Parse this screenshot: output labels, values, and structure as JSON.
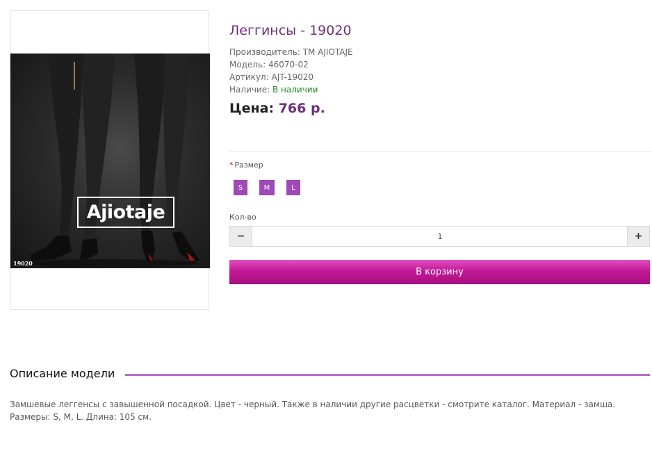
{
  "product": {
    "image_alt": "Леггинсы - 19020",
    "brand_logo": "Ajiotaje",
    "sku_tag": "19020",
    "title": "Леггинсы - 19020",
    "manufacturer_label": "Производитель:",
    "manufacturer_value": "TM AJIOTAJE",
    "model_label": "Модель:",
    "model_value": "46070-02",
    "article_label": "Артикул:",
    "article_value": "AJT-19020",
    "availability_label": "Наличие:",
    "availability_value": "В наличии",
    "price_label": "Цена:",
    "price_value": "766 р."
  },
  "options": {
    "required_mark": "*",
    "size_label": "Размер",
    "sizes": [
      "S",
      "M",
      "L"
    ],
    "quantity_label": "Кол-во",
    "quantity_value": "1",
    "minus_icon": "minus-icon",
    "plus_icon": "plus-icon"
  },
  "cart": {
    "button_label": "В корзину"
  },
  "description": {
    "heading": "Описание модели",
    "text": "Замшевые леггенсы с завышенной посадкой. Цвет - черный. Также в наличии другие расцветки - смотрите каталог. Материал - замша. Размеры: S, M, L. Длина: 105 см."
  },
  "colors": {
    "title": "#6f2f79",
    "accent": "#9f48b7",
    "cart_button": "#c31a98",
    "in_stock": "#1f8a1f",
    "heading_rule": "#b56cc8"
  }
}
